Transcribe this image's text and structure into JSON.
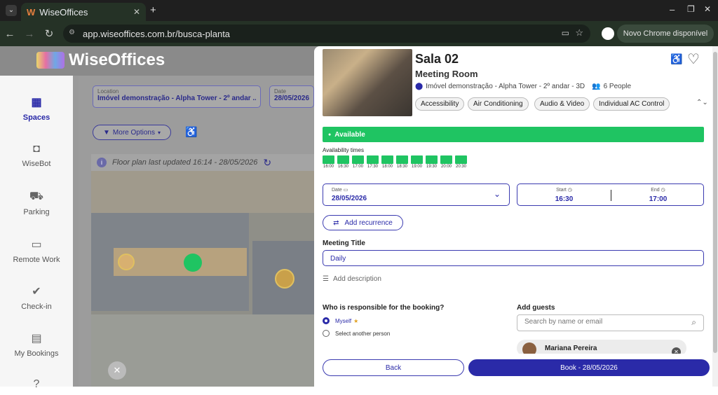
{
  "browser": {
    "tab_title": "WiseOffices",
    "url": "app.wiseoffices.com.br/busca-planta",
    "chrome_update": "Novo Chrome disponível"
  },
  "app": {
    "brand": "WiseOffices",
    "nav": [
      {
        "label": "Spaces",
        "icon": "building-icon",
        "active": true
      },
      {
        "label": "WiseBot",
        "icon": "bot-icon"
      },
      {
        "label": "Parking",
        "icon": "car-icon"
      },
      {
        "label": "Remote Work",
        "icon": "monitor-icon"
      },
      {
        "label": "Check-in",
        "icon": "check-circle-icon"
      },
      {
        "label": "My Bookings",
        "icon": "calendar-check-icon"
      }
    ],
    "filters": {
      "location_label": "Location",
      "location_value": "Imóvel demonstração - Alpha Tower - 2º andar ...",
      "date_label": "Date",
      "date_value": "28/05/2026",
      "more_options": "More Options"
    },
    "floor_plan_note": "Floor plan last updated 16:14 - 28/05/2026"
  },
  "panel": {
    "room_name": "Sala 02",
    "room_type": "Meeting Room",
    "location": "Imóvel demonstração - Alpha Tower - 2º andar - 3D",
    "capacity": "6 People",
    "amenities": [
      "Accessibility",
      "Air Conditioning",
      "Audio & Video",
      "Individual AC Control"
    ],
    "status": "Available",
    "availability_label": "Availability times",
    "times": [
      "16:00",
      "16:30",
      "17:00",
      "17:30",
      "18:00",
      "18:30",
      "19:00",
      "19:30",
      "20:00",
      "20:30"
    ],
    "date_label": "Date",
    "date_value": "28/05/2026",
    "start_label": "Start",
    "start_value": "16:30",
    "end_label": "End",
    "end_value": "17:00",
    "add_recurrence": "Add recurrence",
    "meeting_title_label": "Meeting Title",
    "meeting_title_value": "Daily",
    "add_description": "Add description",
    "responsible_label": "Who is responsible for the booking?",
    "option_myself": "Myself",
    "option_other": "Select another person",
    "guests_label": "Add guests",
    "guests_placeholder": "Search by name or email",
    "guest_name": "Mariana Pereira",
    "back": "Back",
    "book": "Book - 28/05/2026"
  },
  "colors": {
    "primary": "#2a2aa8",
    "available": "#1fc462"
  }
}
